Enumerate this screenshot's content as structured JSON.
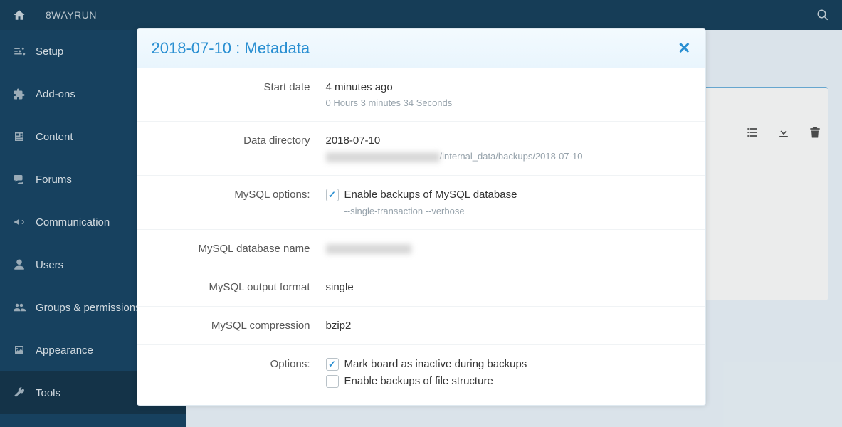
{
  "topbar": {
    "brand": "8WAYRUN"
  },
  "sidebar": {
    "items": [
      {
        "label": "Setup"
      },
      {
        "label": "Add-ons"
      },
      {
        "label": "Content"
      },
      {
        "label": "Forums"
      },
      {
        "label": "Communication"
      },
      {
        "label": "Users"
      },
      {
        "label": "Groups & permissions"
      },
      {
        "label": "Appearance"
      },
      {
        "label": "Tools"
      }
    ]
  },
  "modal": {
    "title": "2018-07-10 : Metadata",
    "rows": {
      "start_date": {
        "label": "Start date",
        "value": "4 minutes ago",
        "sub": "0 Hours 3 minutes 34 Seconds"
      },
      "data_directory": {
        "label": "Data directory",
        "value": "2018-07-10",
        "path_suffix": "/internal_data/backups/2018-07-10"
      },
      "mysql_options": {
        "label": "MySQL options:",
        "opt1": "Enable backups of MySQL database",
        "opt1_sub": "--single-transaction --verbose"
      },
      "mysql_db_name": {
        "label": "MySQL database name"
      },
      "mysql_output": {
        "label": "MySQL output format",
        "value": "single"
      },
      "mysql_compression": {
        "label": "MySQL compression",
        "value": "bzip2"
      },
      "options": {
        "label": "Options:",
        "opt1": "Mark board as inactive during backups",
        "opt2": "Enable backups of file structure"
      }
    }
  }
}
